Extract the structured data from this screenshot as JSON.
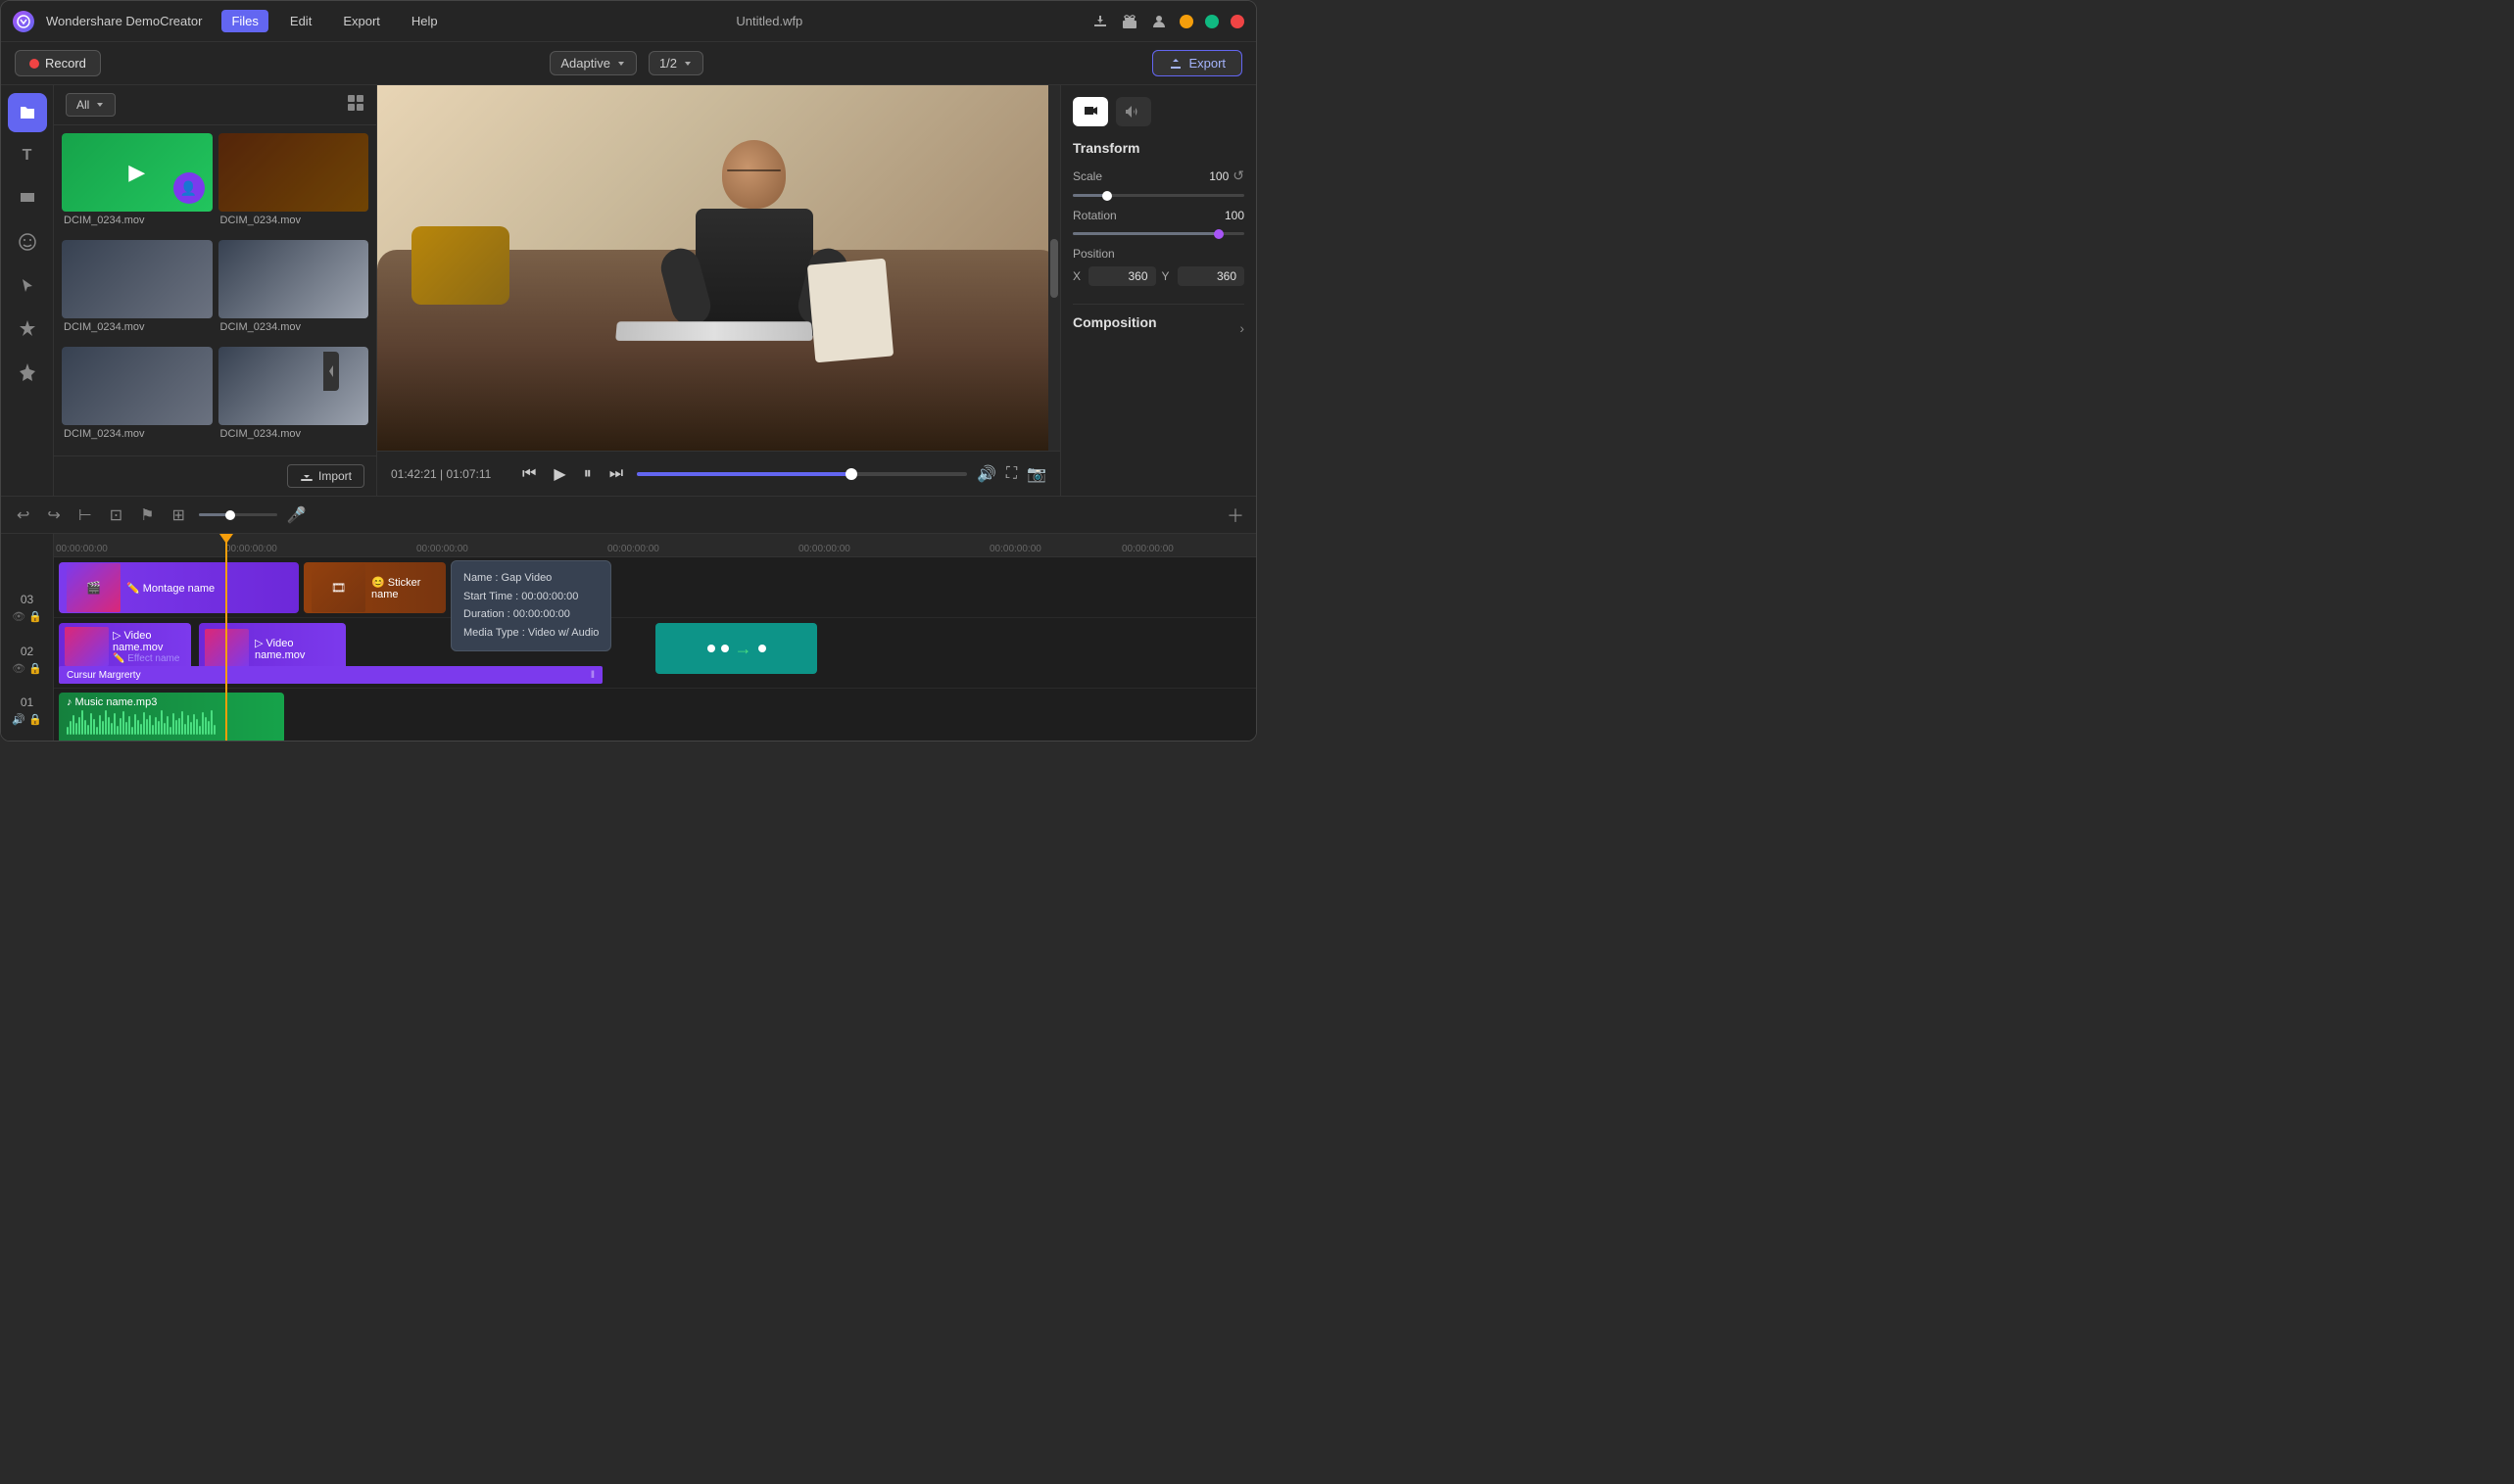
{
  "app": {
    "name": "Wondershare DemoCreator",
    "title": "Untitled.wfp",
    "logo": "W"
  },
  "menu": {
    "items": [
      "Files",
      "Edit",
      "Export",
      "Help"
    ],
    "active": "Files"
  },
  "toolbar": {
    "record_label": "Record",
    "adaptive_label": "Adaptive",
    "zoom_label": "1/2",
    "export_label": "Export"
  },
  "titlebar_icons": {
    "download": "⬇",
    "cart": "🛒",
    "user": "👤",
    "minimize": "−",
    "maximize": "⬜",
    "close": "✕"
  },
  "sidebar": {
    "icons": [
      {
        "name": "folder-icon",
        "symbol": "📁",
        "active": true
      },
      {
        "name": "text-icon",
        "symbol": "T",
        "active": false
      },
      {
        "name": "speech-icon",
        "symbol": "💬",
        "active": false
      },
      {
        "name": "emoji-icon",
        "symbol": "☺",
        "active": false
      },
      {
        "name": "cursor-icon",
        "symbol": "◁",
        "active": false
      },
      {
        "name": "effects-icon",
        "symbol": "✦",
        "active": false
      },
      {
        "name": "pin-icon",
        "symbol": "📌",
        "active": false
      }
    ]
  },
  "media_panel": {
    "filter_label": "All",
    "import_label": "Import",
    "items": [
      {
        "name": "DCIM_0234.mov",
        "thumb": "1"
      },
      {
        "name": "DCIM_0234.mov",
        "thumb": "2"
      },
      {
        "name": "DCIM_0234.mov",
        "thumb": "3"
      },
      {
        "name": "DCIM_0234.mov",
        "thumb": "4"
      },
      {
        "name": "DCIM_0234.mov",
        "thumb": "5"
      },
      {
        "name": "DCIM_0234.mov",
        "thumb": "6"
      }
    ]
  },
  "playback": {
    "current_time": "01:42:21",
    "total_time": "01:07:11",
    "time_display": "01:42:21 | 01:07:11",
    "progress_percent": 65
  },
  "right_panel": {
    "transform_title": "Transform",
    "scale_label": "Scale",
    "scale_value": "100",
    "rotation_label": "Rotation",
    "rotation_value": "100",
    "position_label": "Position",
    "position_x_label": "X",
    "position_x_value": "360",
    "position_y_label": "Y",
    "position_y_value": "360",
    "composition_label": "Composition"
  },
  "timeline": {
    "ruler_marks": [
      "00:00:00:00",
      "00:00:00:00",
      "00:00:00:00",
      "00:00:00:00",
      "00:00:00:00",
      "00:00:00:00",
      "00:00:00:00"
    ],
    "tracks": [
      {
        "num": "03",
        "clips": [
          {
            "type": "montage",
            "label": "Montage name",
            "icon": "✏️"
          },
          {
            "type": "sticker",
            "label": "Sticker name",
            "icon": "😊"
          }
        ]
      },
      {
        "num": "02",
        "clips": [
          {
            "type": "video1",
            "label": "Video name.mov",
            "icon": "▷",
            "effect": "Effect name"
          },
          {
            "type": "video2",
            "label": "Video name.mov",
            "icon": "▷"
          },
          {
            "type": "video3",
            "label": ""
          }
        ]
      },
      {
        "num": "01",
        "clips": [
          {
            "type": "music",
            "label": "Music name.mp3",
            "icon": "♪"
          }
        ]
      }
    ],
    "tooltip": {
      "name_label": "Name :",
      "name_value": "Gap Video",
      "start_label": "Start Time :",
      "start_value": "00:00:00:00",
      "duration_label": "Duration :",
      "duration_value": "00:00:00:00",
      "media_label": "Media Type :",
      "media_value": "Video w/ Audio"
    },
    "cursor_label": "Cursur Margrerty"
  }
}
